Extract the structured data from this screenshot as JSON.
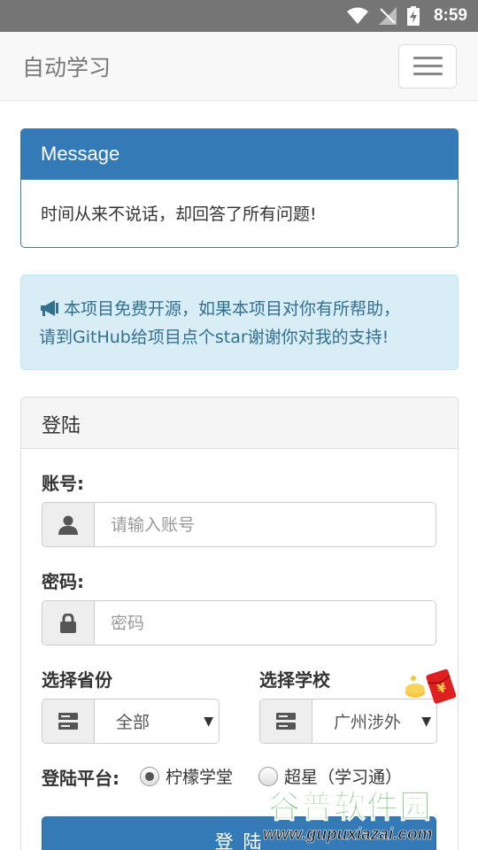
{
  "status_bar": {
    "time": "8:59"
  },
  "navbar": {
    "brand": "自动学习"
  },
  "message_panel": {
    "heading": "Message",
    "body": "时间从来不说话，却回答了所有问题!"
  },
  "notice": {
    "line1": "本项目免费开源，如果本项目对你有所帮助，",
    "line2": "请到GitHub给项目点个star谢谢你对我的支持!"
  },
  "login_panel": {
    "heading": "登陆",
    "account_label": "账号:",
    "account_placeholder": "请输入账号",
    "password_label": "密码:",
    "password_placeholder": "密码",
    "province_label": "选择省份",
    "province_value": "全部",
    "school_label": "选择学校",
    "school_value": "广州涉外",
    "platform_label": "登陆平台:",
    "platform_options": [
      "柠檬学堂",
      "超星（学习通）"
    ],
    "submit_label": "登 陆"
  },
  "watermark": {
    "title": "谷普软件园",
    "url": "www.gupuxiazai.com"
  },
  "colors": {
    "primary": "#337ab7",
    "info_bg": "#d9edf7",
    "info_text": "#31708f",
    "statusbar": "#757575"
  },
  "icons": [
    "wifi-icon",
    "signal-off-icon",
    "battery-charging-icon",
    "menu-icon",
    "megaphone-icon",
    "user-icon",
    "lock-icon",
    "server-icon",
    "radio-icon",
    "red-packet-icon"
  ]
}
